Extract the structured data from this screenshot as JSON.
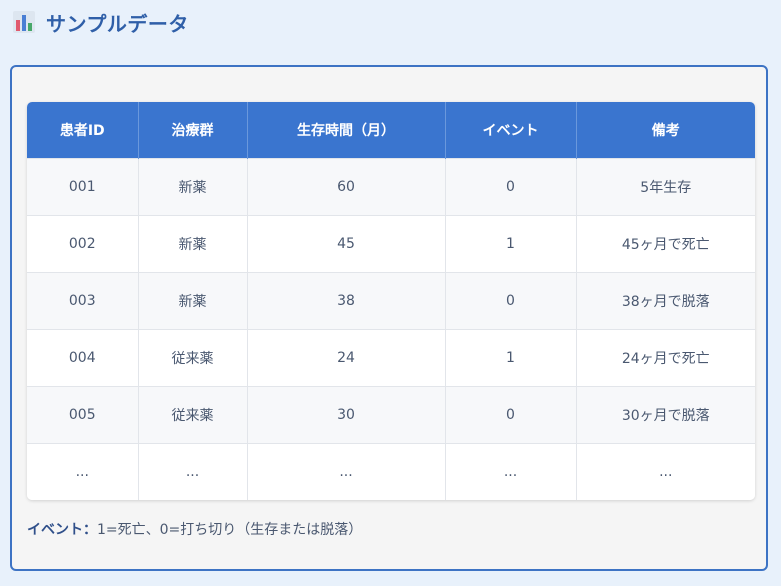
{
  "header": {
    "icon": "bar-chart-icon",
    "title": "サンプルデータ"
  },
  "table": {
    "columns": [
      "患者ID",
      "治療群",
      "生存時間（月）",
      "イベント",
      "備考"
    ],
    "rows": [
      [
        "001",
        "新薬",
        "60",
        "0",
        "5年生存"
      ],
      [
        "002",
        "新薬",
        "45",
        "1",
        "45ヶ月で死亡"
      ],
      [
        "003",
        "新薬",
        "38",
        "0",
        "38ヶ月で脱落"
      ],
      [
        "004",
        "従来薬",
        "24",
        "1",
        "24ヶ月で死亡"
      ],
      [
        "005",
        "従来薬",
        "30",
        "0",
        "30ヶ月で脱落"
      ],
      [
        "...",
        "...",
        "...",
        "...",
        "..."
      ]
    ]
  },
  "note": {
    "label": "イベント：",
    "text": "1=死亡、0=打ち切り（生存または脱落）"
  },
  "colors": {
    "header_bg": "#3a75cf",
    "title": "#2f5fa8",
    "border": "#3d73c4"
  }
}
